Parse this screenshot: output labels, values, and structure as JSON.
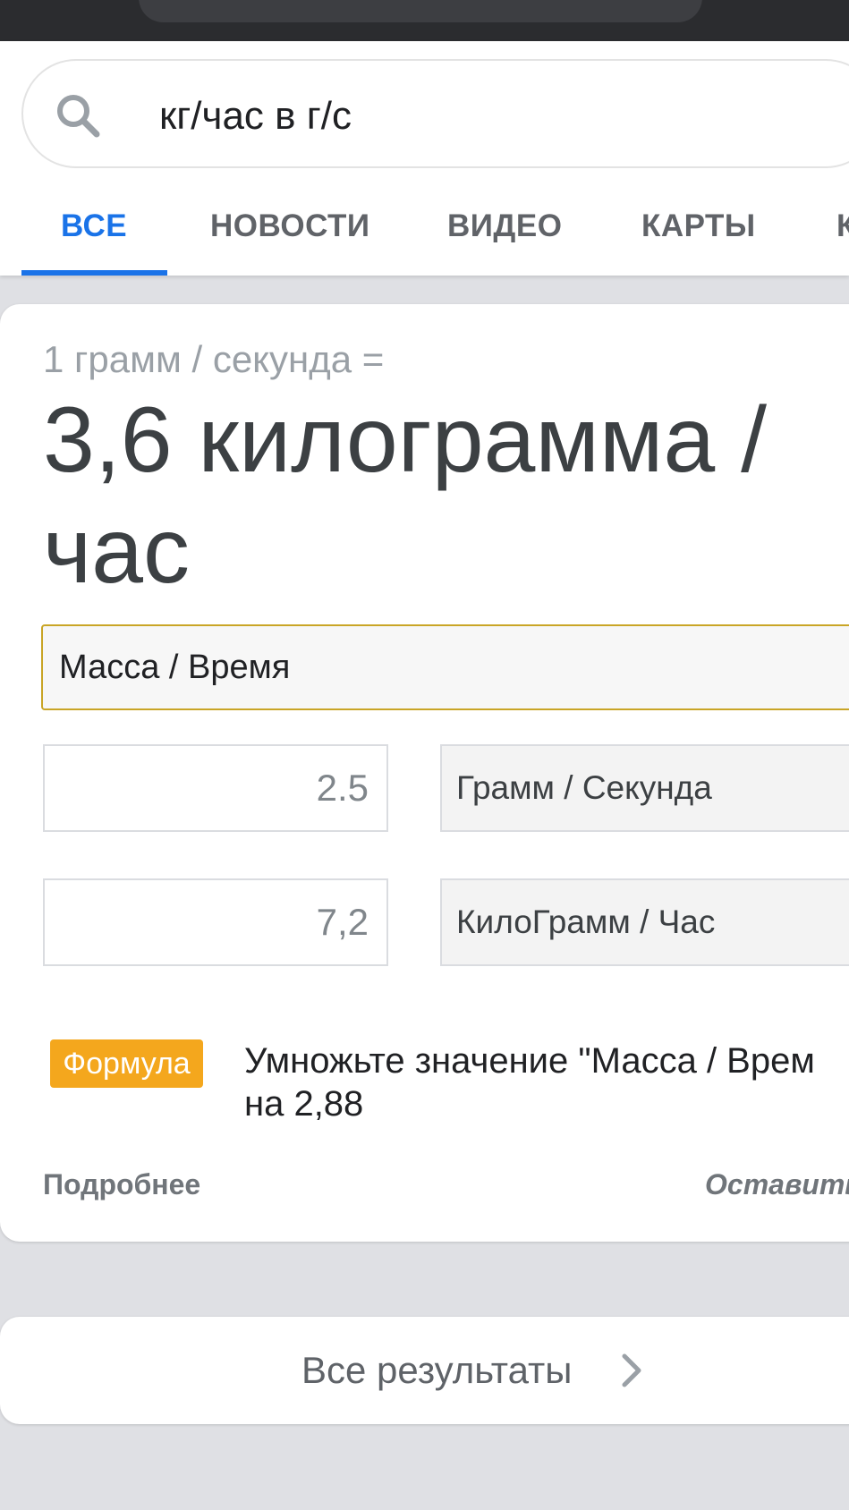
{
  "search": {
    "query": "кг/час в г/с",
    "icon": "search-icon"
  },
  "tabs": [
    {
      "label": "ВСЕ",
      "active": true
    },
    {
      "label": "НОВОСТИ",
      "active": false
    },
    {
      "label": "ВИДЕО",
      "active": false
    },
    {
      "label": "КАРТЫ",
      "active": false
    },
    {
      "label": "К",
      "active": false
    }
  ],
  "converter": {
    "result_sub": "1 грамм / секунда =",
    "result_main": "3,6 килограмма / час",
    "category": "Масса / Время",
    "from": {
      "value": "2.5",
      "unit": "Грамм / Секунда"
    },
    "to": {
      "value": "7,2",
      "unit": "КилоГрамм / Час"
    },
    "formula_badge": "Формула",
    "formula_line1": "Умножьте значение \"Масса / Врем",
    "formula_line2": "на 2,88",
    "more_link": "Подробнее",
    "feedback_link": "Оставить о"
  },
  "all_results": {
    "label": "Все результаты",
    "icon": "chevron-right-icon"
  },
  "colors": {
    "accent": "#1a73e8",
    "formula_badge": "#f4a71d",
    "category_border": "#c9a526"
  }
}
